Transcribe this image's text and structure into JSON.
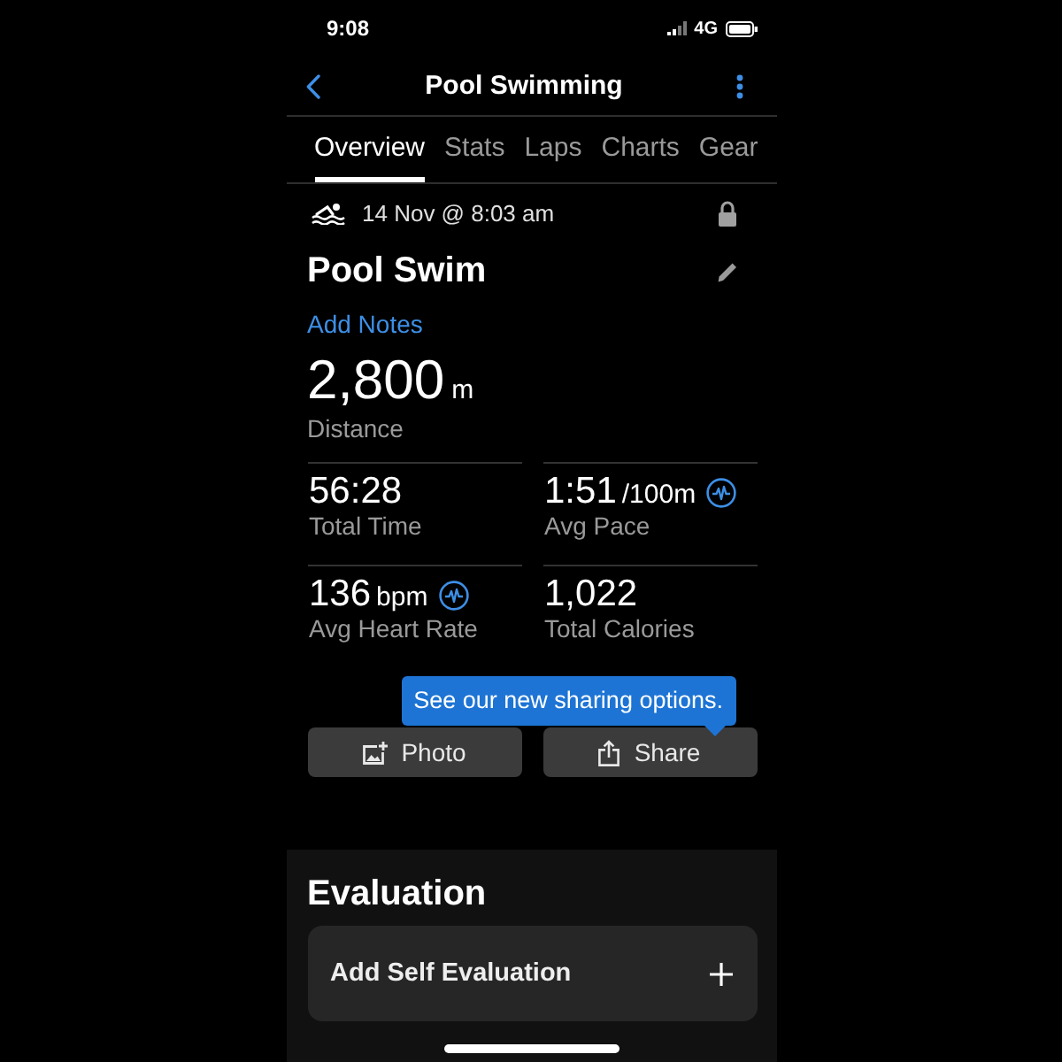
{
  "status_bar": {
    "time": "9:08",
    "network": "4G"
  },
  "header": {
    "title": "Pool Swimming"
  },
  "tabs": [
    {
      "label": "Overview",
      "selected": true
    },
    {
      "label": "Stats",
      "selected": false
    },
    {
      "label": "Laps",
      "selected": false
    },
    {
      "label": "Charts",
      "selected": false
    },
    {
      "label": "Gear",
      "selected": false
    }
  ],
  "activity": {
    "date": "14 Nov @ 8:03 am",
    "title": "Pool Swim",
    "notes_link": "Add Notes",
    "distance": {
      "value": "2,800",
      "unit": "m",
      "label": "Distance"
    }
  },
  "stats": [
    {
      "value": "56:28",
      "label": "Total Time",
      "chart_link": false
    },
    {
      "value": "1:51",
      "unit": "/100m",
      "label": "Avg Pace",
      "chart_link": true
    },
    {
      "value": "136",
      "unit": "bpm",
      "label": "Avg Heart Rate",
      "chart_link": true
    },
    {
      "value": "1,022",
      "label": "Total Calories",
      "chart_link": false
    }
  ],
  "tooltip": {
    "text": "See our new sharing options."
  },
  "actions": [
    {
      "label": "Photo",
      "kind": "photo"
    },
    {
      "label": "Share",
      "kind": "share"
    }
  ],
  "evaluation": {
    "heading": "Evaluation",
    "item": "Add Self Evaluation"
  }
}
